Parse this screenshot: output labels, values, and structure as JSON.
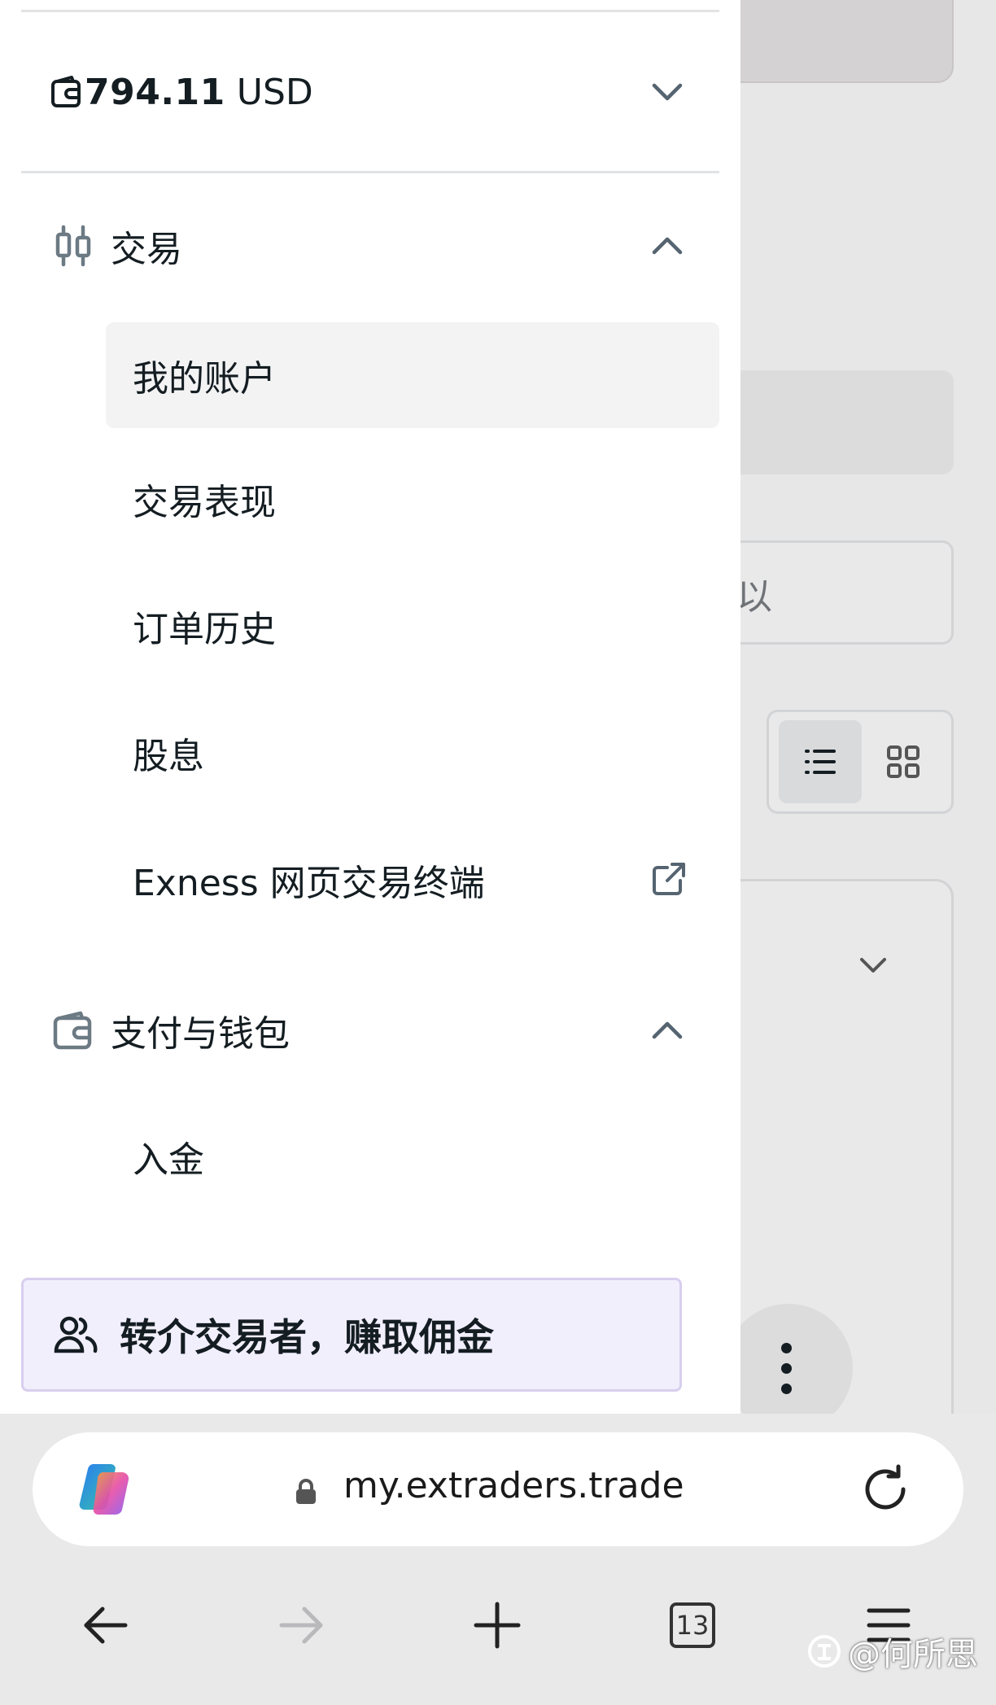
{
  "drawer": {
    "balance": {
      "amount": "794.11",
      "currency": "USD"
    },
    "trading_section": {
      "label": "交易",
      "items": [
        {
          "label": "我的账户",
          "selected": true
        },
        {
          "label": "交易表现"
        },
        {
          "label": "订单历史"
        },
        {
          "label": "股息"
        },
        {
          "label": "Exness 网页交易终端",
          "external": true
        }
      ]
    },
    "payments_section": {
      "label": "支付与钱包",
      "items": [
        {
          "label": "入金"
        }
      ]
    },
    "referral": {
      "label": "转介交易者，赚取佣金"
    }
  },
  "background": {
    "input_partial_text": "以"
  },
  "browser": {
    "url": "my.extraders.trade",
    "tab_count": "13"
  },
  "watermark": {
    "text": "@何所思"
  },
  "colors": {
    "referral_bg": "#f2effd",
    "referral_border": "#d8cfee",
    "selected_bg": "#f3f3f4",
    "icon_gray": "#6c7a84"
  }
}
